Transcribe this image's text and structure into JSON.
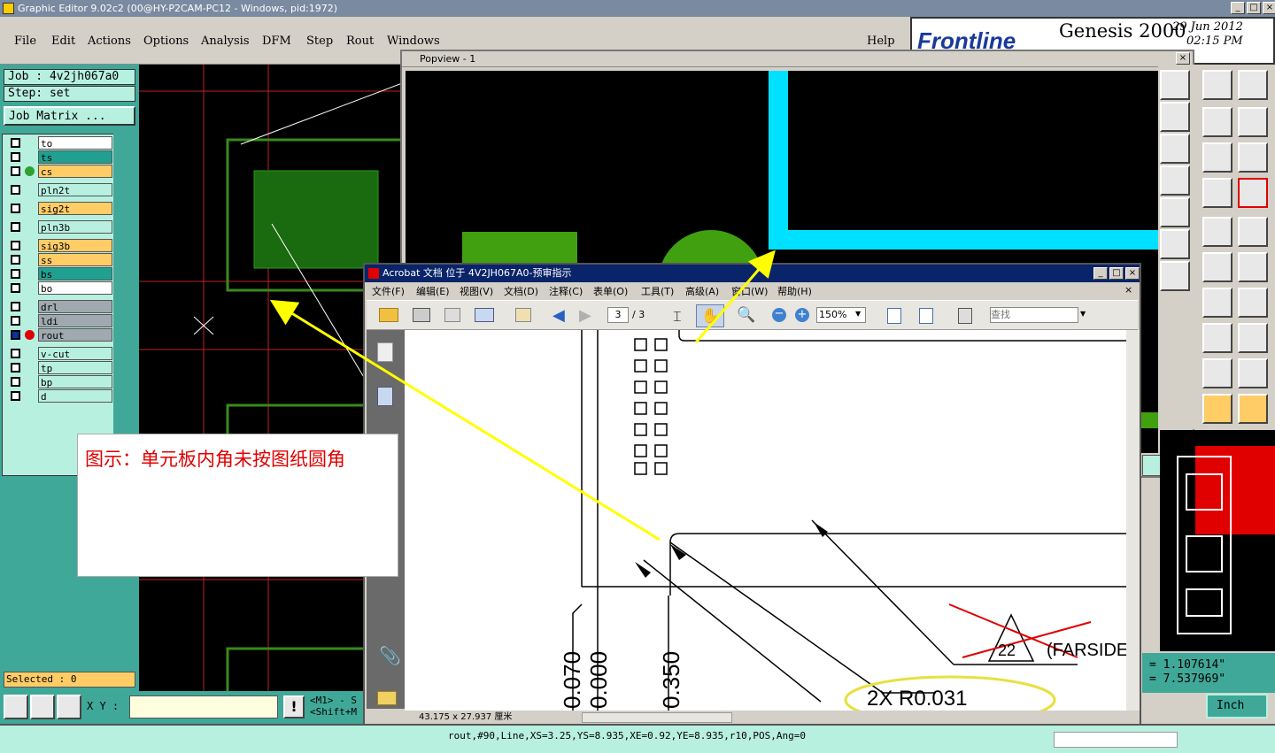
{
  "window": {
    "title": "Graphic Editor 9.02c2 (00@HY-P2CAM-PC12 - Windows, pid:1972)"
  },
  "menu": {
    "items": [
      "File",
      "Edit",
      "Actions",
      "Options",
      "Analysis",
      "DFM",
      "Step",
      "Rout",
      "Windows"
    ],
    "help": "Help"
  },
  "brand": {
    "logo": "Frontline",
    "product": "Genesis 2000",
    "date": "29 Jun 2012",
    "time": "02:15 PM"
  },
  "job": {
    "job_line": "Job : 4v2jh067a0",
    "step_line": "Step: set",
    "matrix_button": "Job Matrix ..."
  },
  "layers": [
    {
      "name": "to",
      "color": "#ffffff"
    },
    {
      "name": "ts",
      "color": "#20a090"
    },
    {
      "name": "cs",
      "color": "#ffcc66"
    },
    {
      "name": "pln2t",
      "color": "#b8f0e0"
    },
    {
      "name": "sig2t",
      "color": "#ffcc66"
    },
    {
      "name": "pln3b",
      "color": "#b8f0e0"
    },
    {
      "name": "sig3b",
      "color": "#ffcc66"
    },
    {
      "name": "ss",
      "color": "#ffcc66"
    },
    {
      "name": "bs",
      "color": "#20a090"
    },
    {
      "name": "bo",
      "color": "#ffffff"
    },
    {
      "name": "drl",
      "color": "#a0a8b0"
    },
    {
      "name": "ldi",
      "color": "#a0a8b0"
    },
    {
      "name": "rout",
      "color": "#a0a8b0"
    },
    {
      "name": "v-cut",
      "color": "#b8f0e0"
    },
    {
      "name": "tp",
      "color": "#b8f0e0"
    },
    {
      "name": "bp",
      "color": "#b8f0e0"
    },
    {
      "name": "d",
      "color": "#b8f0e0"
    }
  ],
  "selected": "Selected : 0",
  "popview": {
    "title": "Popview - 1"
  },
  "acrobat": {
    "title": "Acrobat 文档 位于 4V2JH067A0-预审指示",
    "menu": [
      "文件(F)",
      "编辑(E)",
      "视图(V)",
      "文档(D)",
      "注释(C)",
      "表单(O)",
      "工具(T)",
      "高级(A)",
      "窗口(W)",
      "帮助(H)"
    ],
    "page_current": "3",
    "page_total": "/ 3",
    "zoom": "150%",
    "search_placeholder": "查找",
    "status_size": "43.175 x 27.937 厘米",
    "drawing": {
      "dim1": "0.070",
      "dim2": "0.000",
      "dim3": "0.350",
      "radius_note": "2X R0.031",
      "triangle_label": "22",
      "farside": "(FARSIDE"
    }
  },
  "annotation": {
    "note": "图示：单元板内角未按图纸圆角"
  },
  "coords": {
    "x": "= 1.107614\"",
    "y": "= 7.537969\""
  },
  "units": "Inch",
  "bottom": {
    "xy_label": "X Y :",
    "hint1": "<M1> - S",
    "hint2": "<Shift+M"
  },
  "status_line": "rout,#90,Line,XS=3.25,YS=8.935,XE=0.92,YE=8.935,r10,POS,Ang=0"
}
